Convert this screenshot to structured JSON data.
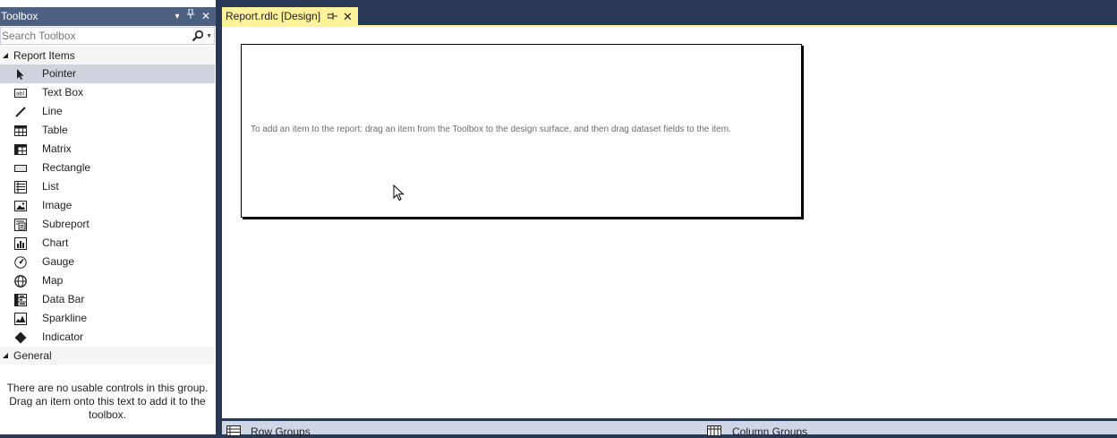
{
  "toolbox": {
    "title": "Toolbox",
    "dropdown_glyph": "▾",
    "pin_glyph": "⊥",
    "close_glyph": "✕",
    "search_placeholder": "Search Toolbox",
    "groups": {
      "report_items": "Report Items",
      "general": "General"
    },
    "items": [
      {
        "label": "Pointer",
        "icon": "pointer-icon"
      },
      {
        "label": "Text Box",
        "icon": "textbox-icon"
      },
      {
        "label": "Line",
        "icon": "line-icon"
      },
      {
        "label": "Table",
        "icon": "table-icon"
      },
      {
        "label": "Matrix",
        "icon": "matrix-icon"
      },
      {
        "label": "Rectangle",
        "icon": "rectangle-icon"
      },
      {
        "label": "List",
        "icon": "list-icon"
      },
      {
        "label": "Image",
        "icon": "image-icon"
      },
      {
        "label": "Subreport",
        "icon": "subreport-icon"
      },
      {
        "label": "Chart",
        "icon": "chart-icon"
      },
      {
        "label": "Gauge",
        "icon": "gauge-icon"
      },
      {
        "label": "Map",
        "icon": "map-icon"
      },
      {
        "label": "Data Bar",
        "icon": "databar-icon"
      },
      {
        "label": "Sparkline",
        "icon": "sparkline-icon"
      },
      {
        "label": "Indicator",
        "icon": "indicator-icon"
      }
    ],
    "general_message": "There are no usable controls in this group. Drag an item onto this text to add it to the toolbox."
  },
  "document": {
    "tab_title": "Report.rdlc [Design]",
    "tab_pin_glyph": "⊣",
    "tab_close_glyph": "✕",
    "design_hint": "To add an item to the report: drag an item from the Toolbox to the design surface, and then drag dataset fields to the item."
  },
  "groups_bar": {
    "row_groups": "Row Groups",
    "column_groups": "Column Groups"
  },
  "colors": {
    "title_bar": "#4d6082",
    "frame": "#293955",
    "tab_active": "#fff29d",
    "selected_item": "#cfd3de"
  }
}
